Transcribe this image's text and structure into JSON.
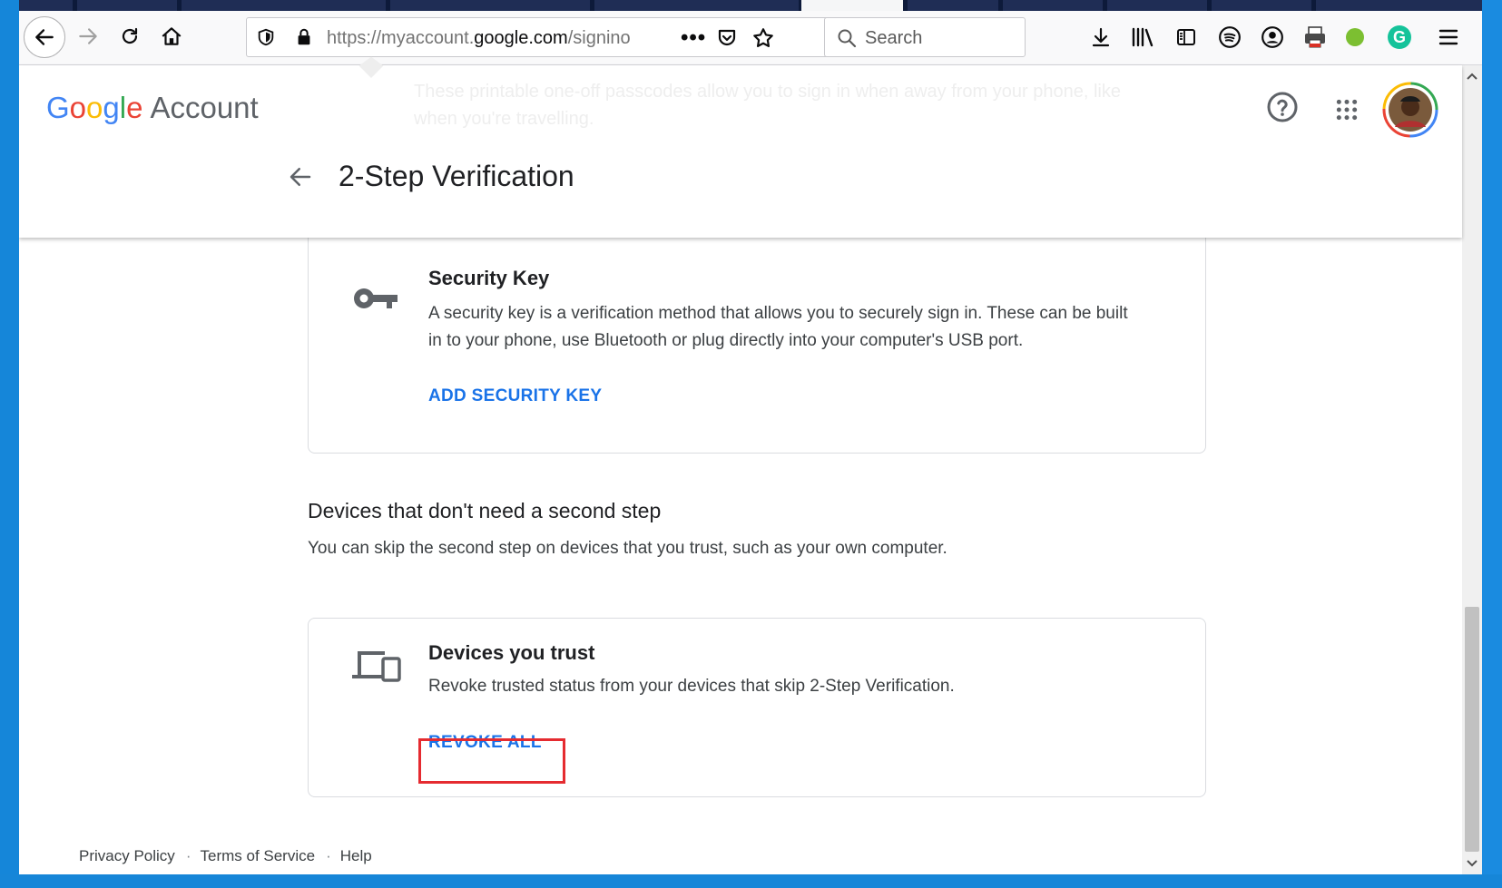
{
  "browser": {
    "url_prefix": "https://myaccount.",
    "url_domain": "google.com",
    "url_suffix": "/signino",
    "search_placeholder": "Search"
  },
  "header": {
    "logo_letters": [
      "G",
      "o",
      "o",
      "g",
      "l",
      "e"
    ],
    "account_label": "Account",
    "page_title": "2-Step Verification",
    "faded_text": "These printable one-off passcodes allow you to sign in when away from your phone, like when you're travelling."
  },
  "security_key": {
    "title": "Security Key",
    "description": "A security key is a verification method that allows you to securely sign in. These can be built in to your phone, use Bluetooth or plug directly into your computer's USB port.",
    "action": "ADD SECURITY KEY"
  },
  "devices_section": {
    "title": "Devices that don't need a second step",
    "description": "You can skip the second step on devices that you trust, such as your own computer."
  },
  "devices_card": {
    "title": "Devices you trust",
    "description": "Revoke trusted status from your devices that skip 2-Step Verification.",
    "action": "REVOKE ALL"
  },
  "footer": {
    "links": [
      "Privacy Policy",
      "Terms of Service",
      "Help"
    ],
    "separator": "·"
  },
  "colors": {
    "link": "#1a73e8",
    "highlight": "#e52b30"
  }
}
